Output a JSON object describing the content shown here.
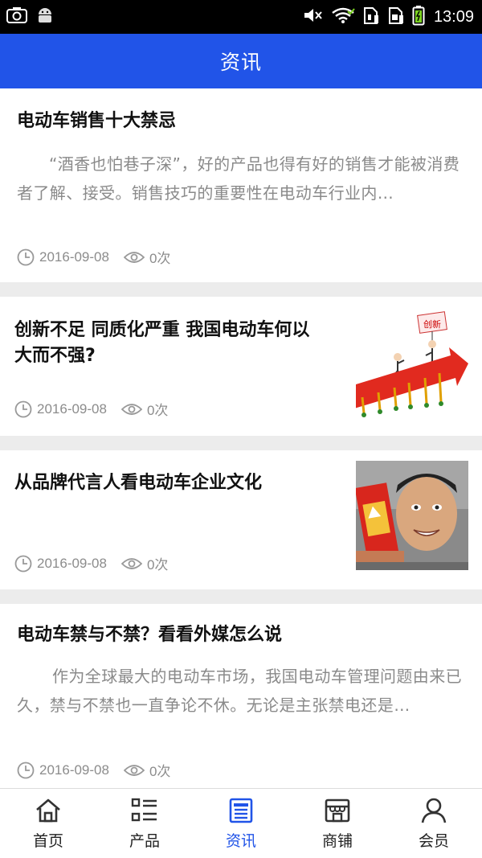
{
  "status_bar": {
    "time": "13:09",
    "left_icons": [
      "camera-icon",
      "android-icon"
    ],
    "right_icons": [
      "mute-icon",
      "wifi-icon",
      "sim1-icon",
      "sim2-icon",
      "battery-icon"
    ]
  },
  "header": {
    "title": "资讯"
  },
  "news": [
    {
      "title": "电动车销售十大禁忌",
      "summary": "“酒香也怕巷子深”，好的产品也得有好的销售才能被消费者了解、接受。销售技巧的重要性在电动车行业内…",
      "date": "2016-09-08",
      "views": "0次",
      "has_thumb": false
    },
    {
      "title": "创新不足 同质化严重 我国电动车何以大而不强?",
      "date": "2016-09-08",
      "views": "0次",
      "has_thumb": true,
      "thumb_icon": "innovation-arrow-illustration",
      "thumb_text": "创新"
    },
    {
      "title": "从品牌代言人看电动车企业文化",
      "date": "2016-09-08",
      "views": "0次",
      "has_thumb": true,
      "thumb_icon": "spokesperson-photo"
    },
    {
      "title": "电动车禁与不禁？看看外媒怎么说",
      "summary": "作为全球最大的电动车市场，我国电动车管理问题由来已久，禁与不禁也一直争论不休。无论是主张禁电还是…",
      "date": "2016-09-08",
      "views": "0次",
      "has_thumb": false
    }
  ],
  "tabs": [
    {
      "label": "首页",
      "icon": "home-icon",
      "active": false
    },
    {
      "label": "产品",
      "icon": "list-icon",
      "active": false
    },
    {
      "label": "资讯",
      "icon": "document-icon",
      "active": true
    },
    {
      "label": "商铺",
      "icon": "shop-icon",
      "active": false
    },
    {
      "label": "会员",
      "icon": "user-icon",
      "active": false
    }
  ],
  "colors": {
    "primary": "#2154e8",
    "background": "#ececec",
    "meta_text": "#8c8c8c"
  }
}
